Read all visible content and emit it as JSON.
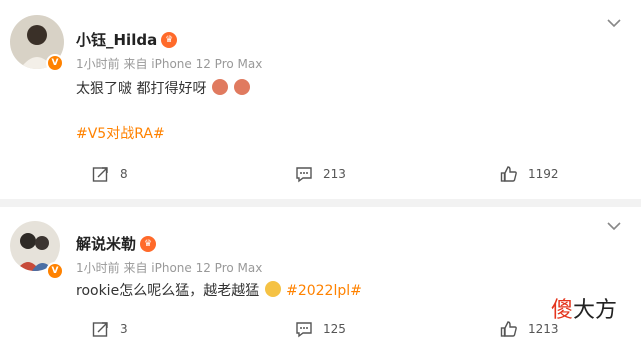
{
  "posts": [
    {
      "username": "小钰_Hilda",
      "meta": "1小时前  来自 iPhone 12 Pro Max",
      "text": "太狠了啵 都打得好呀",
      "hashtag": "#V5对战RA#",
      "reposts": "8",
      "comments": "213",
      "likes": "1192"
    },
    {
      "username": "解说米勒",
      "meta": "1小时前  来自 iPhone 12 Pro Max",
      "text": "rookie怎么呢么猛，越老越猛",
      "hashtag": "#2022lpl#",
      "reposts": "3",
      "comments": "125",
      "likes": "1213"
    }
  ],
  "watermark": {
    "part1": "傻",
    "part2": "大方"
  },
  "colors": {
    "accent": "#ff8200",
    "badge": "#ff6a2a"
  },
  "icons": {
    "repost": "share-arrow-icon",
    "comment": "chat-bubble-icon",
    "like": "thumbs-up-icon",
    "menu": "chevron-down-icon"
  }
}
